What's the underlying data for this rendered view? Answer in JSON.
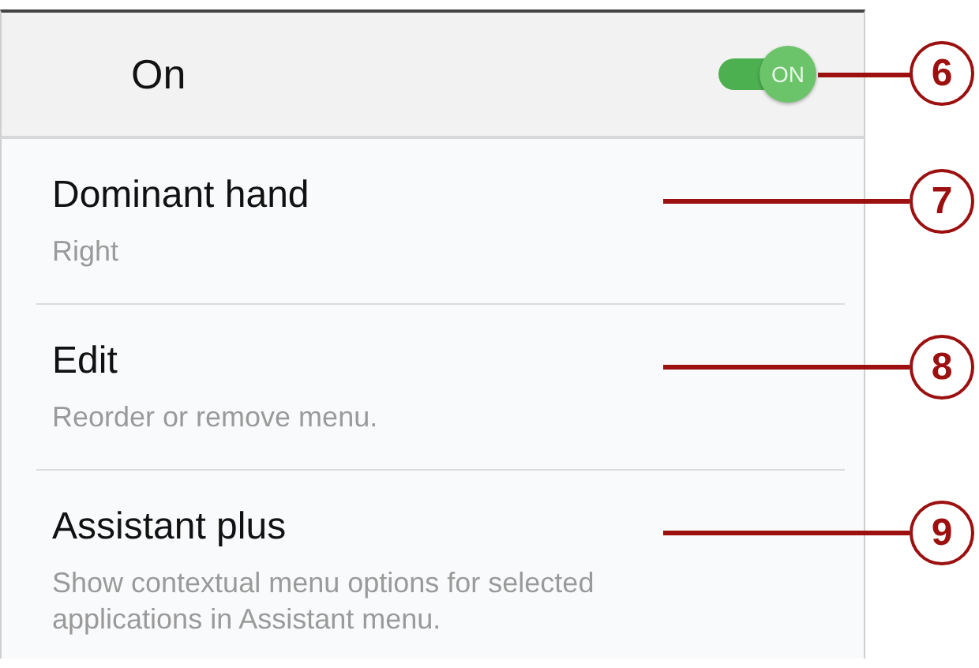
{
  "master_switch": {
    "label": "On",
    "on": true,
    "switch_text": "ON",
    "callout": "6"
  },
  "items": [
    {
      "title": "Dominant hand",
      "subtitle": "Right",
      "callout": "7"
    },
    {
      "title": "Edit",
      "subtitle": "Reorder or remove menu.",
      "callout": "8"
    },
    {
      "title": "Assistant plus",
      "subtitle": "Show contextual menu options for selected applications in Assistant menu.",
      "callout": "9"
    }
  ]
}
